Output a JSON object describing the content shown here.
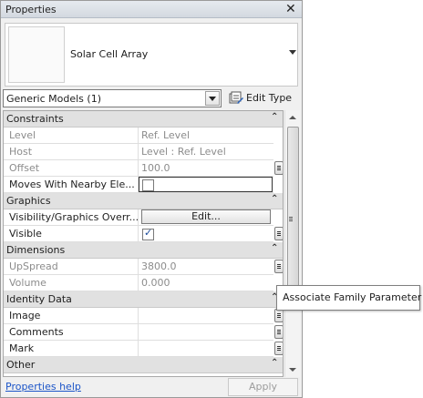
{
  "window": {
    "title": "Properties",
    "close_glyph": "✕"
  },
  "preview": {
    "type_name": "Solar Cell Array"
  },
  "type_selector": {
    "value": "Generic Models (1)"
  },
  "edit_type": {
    "label": "Edit Type",
    "icon": "edit-type-icon"
  },
  "groups": {
    "constraints": {
      "label": "Constraints",
      "collapse_glyph": "⌃"
    },
    "graphics": {
      "label": "Graphics",
      "collapse_glyph": "⌃"
    },
    "dimensions": {
      "label": "Dimensions",
      "collapse_glyph": "⌃"
    },
    "identity": {
      "label": "Identity Data",
      "collapse_glyph": "⌃"
    },
    "other": {
      "label": "Other",
      "collapse_glyph": "⌃"
    }
  },
  "params": {
    "level": {
      "name": "Level",
      "value": "Ref. Level"
    },
    "host": {
      "name": "Host",
      "value": "Level : Ref. Level"
    },
    "offset": {
      "name": "Offset",
      "value": "100.0"
    },
    "moves": {
      "name": "Moves With Nearby Ele...",
      "checked": false
    },
    "visgraphics": {
      "name": "Visibility/Graphics Overr...",
      "button": "Edit..."
    },
    "visible": {
      "name": "Visible",
      "checked": true
    },
    "upspread": {
      "name": "UpSpread",
      "value": "3800.0"
    },
    "volume": {
      "name": "Volume",
      "value": "0.000"
    },
    "image": {
      "name": "Image",
      "value": ""
    },
    "comments": {
      "name": "Comments",
      "value": ""
    },
    "mark": {
      "name": "Mark",
      "value": ""
    }
  },
  "footer": {
    "help_link": "Properties help",
    "apply": "Apply"
  },
  "tooltip": {
    "text": "Associate Family Parameter"
  }
}
